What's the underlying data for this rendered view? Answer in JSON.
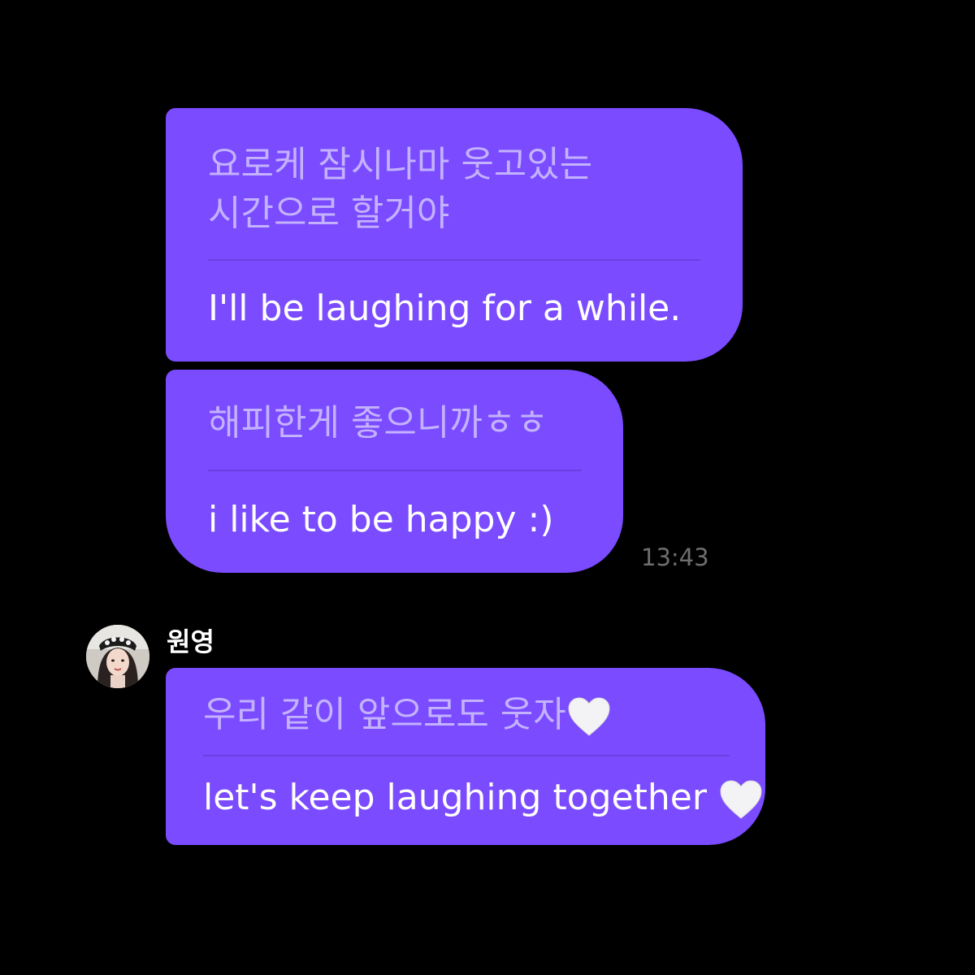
{
  "messages": [
    {
      "korean": "요로케 잠시나마 웃고있는\n시간으로 할거야",
      "english": "I'll be laughing for a while."
    },
    {
      "korean": "해피한게 좋으니까ㅎㅎ",
      "english": "i like to be happy :)"
    }
  ],
  "timestamp": "13:43",
  "reply": {
    "sender_name": "원영",
    "korean": "우리 같이 앞으로도 웃자",
    "english": "let's keep laughing together",
    "heart_icon": "white-heart-icon"
  },
  "colors": {
    "bubble": "#7a4bff",
    "background": "#000000",
    "korean_text": "#c4b2ff",
    "english_text": "#ffffff",
    "timestamp": "#6e6e6e"
  }
}
